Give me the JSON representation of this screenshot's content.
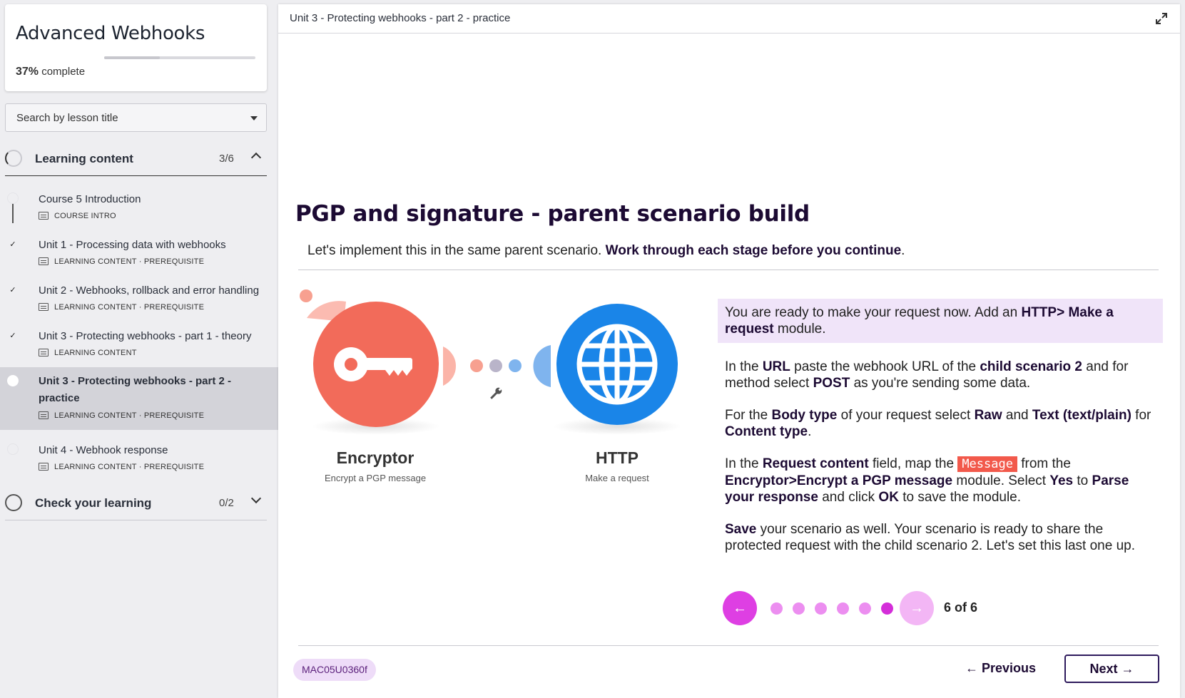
{
  "course": {
    "title": "Advanced Webhooks",
    "progress_percent": "37%",
    "progress_suffix": "complete",
    "progress_value": 0.37
  },
  "search": {
    "label": "Search by lesson title"
  },
  "sections": [
    {
      "title": "Learning content",
      "count": "3/6",
      "expanded": true
    },
    {
      "title": "Check your learning",
      "count": "0/2",
      "expanded": false
    }
  ],
  "lessons": [
    {
      "title": "Course 5 Introduction",
      "meta": "COURSE INTRO",
      "done": false,
      "active": false
    },
    {
      "title": "Unit 1 - Processing data with webhooks",
      "meta": "LEARNING CONTENT · PREREQUISITE",
      "done": true,
      "active": false
    },
    {
      "title": "Unit 2 - Webhooks, rollback and error handling",
      "meta": "LEARNING CONTENT · PREREQUISITE",
      "done": true,
      "active": false
    },
    {
      "title": "Unit 3 - Protecting webhooks - part 1 - theory",
      "meta": "LEARNING CONTENT",
      "done": true,
      "active": false
    },
    {
      "title": "Unit 3 - Protecting webhooks - part 2 - practice",
      "meta": "LEARNING CONTENT · PREREQUISITE",
      "done": false,
      "active": true
    },
    {
      "title": "Unit 4 - Webhook response",
      "meta": "LEARNING CONTENT · PREREQUISITE",
      "done": false,
      "active": false
    }
  ],
  "main": {
    "breadcrumb": "Unit 3 - Protecting webhooks - part 2 - practice",
    "heading": "PGP and signature - parent scenario build",
    "intro_plain": "Let's implement this in the same parent scenario. ",
    "intro_bold": "Work through each stage before you continue",
    "intro_end": "."
  },
  "flow": {
    "module1": {
      "name": "Encryptor",
      "action": "Encrypt a PGP message",
      "color": "#f26b5a"
    },
    "module2": {
      "name": "HTTP",
      "action": "Make a request",
      "color": "#1a85e8"
    }
  },
  "steps": {
    "highlight": {
      "t1": "You are ready to make your request now. Add an ",
      "b1": "HTTP> Make a request",
      "t2": " module."
    },
    "p1": {
      "t1": "In the ",
      "b1": "URL",
      "t2": " paste the webhook URL of the ",
      "b2": "child scenario 2",
      "t3": " and for method select ",
      "b3": "POST",
      "t4": " as you're sending some data."
    },
    "p2": {
      "t1": "For the ",
      "b1": "Body type",
      "t2": " of your request select ",
      "b2": "Raw",
      "t3": " and ",
      "b3": "Text (text/plain)",
      "t4": " for ",
      "b4": "Content type",
      "t5": "."
    },
    "p3": {
      "t1": "In the ",
      "b1": "Request content",
      "t2": " field, map the ",
      "token": "Message",
      "t3": " from the ",
      "b2": "Encryptor>Encrypt a PGP message",
      "t4": " module. Select ",
      "b3": "Yes",
      "t5": " to ",
      "b4": "Parse your response",
      "t6": " and click ",
      "b5": "OK",
      "t7": " to save the module."
    },
    "p4": {
      "b1": "Save",
      "t1": " your scenario as well. Your scenario is ready to share the protected request with the child scenario 2. Let's set this last one up."
    }
  },
  "carousel": {
    "current": 6,
    "total": 6,
    "label": "6 of 6",
    "accent": "#d42ed9"
  },
  "footer": {
    "code": "MAC05U0360f",
    "previous": "Previous",
    "next": "Next"
  }
}
